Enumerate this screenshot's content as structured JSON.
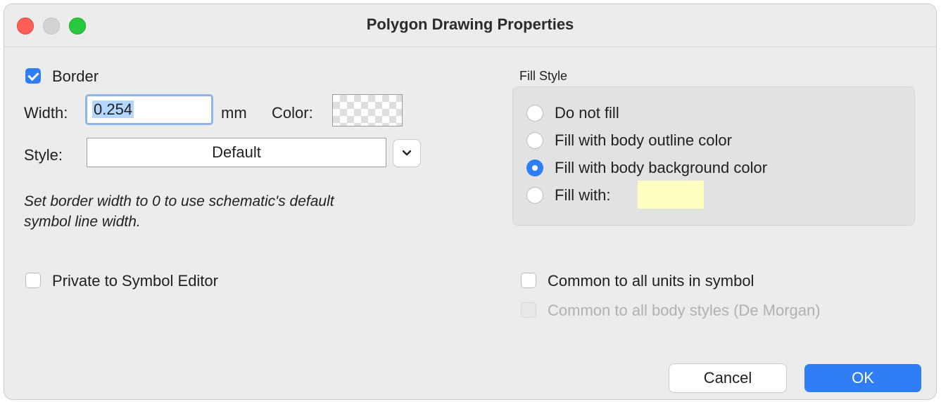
{
  "window": {
    "title": "Polygon Drawing Properties"
  },
  "border": {
    "checkbox_label": "Border",
    "checked": true,
    "width_label": "Width:",
    "width_value": "0.254",
    "width_unit": "mm",
    "color_label": "Color:",
    "style_label": "Style:",
    "style_value": "Default",
    "hint_line1": "Set border width to 0 to use schematic's default",
    "hint_line2": "symbol line width."
  },
  "fill_style": {
    "group_label": "Fill Style",
    "options": [
      {
        "label": "Do not fill",
        "selected": false
      },
      {
        "label": "Fill with body outline color",
        "selected": false
      },
      {
        "label": "Fill with body background color",
        "selected": true
      },
      {
        "label": "Fill with:",
        "selected": false
      }
    ],
    "fill_color": "#ffffc2"
  },
  "options": {
    "private_label": "Private to Symbol Editor",
    "common_units_label": "Common to all units in symbol",
    "common_styles_label": "Common to all body styles (De Morgan)"
  },
  "buttons": {
    "cancel": "Cancel",
    "ok": "OK"
  },
  "colors": {
    "accent": "#2f7ef5",
    "close": "#ff5f57",
    "maximize": "#28c840"
  }
}
